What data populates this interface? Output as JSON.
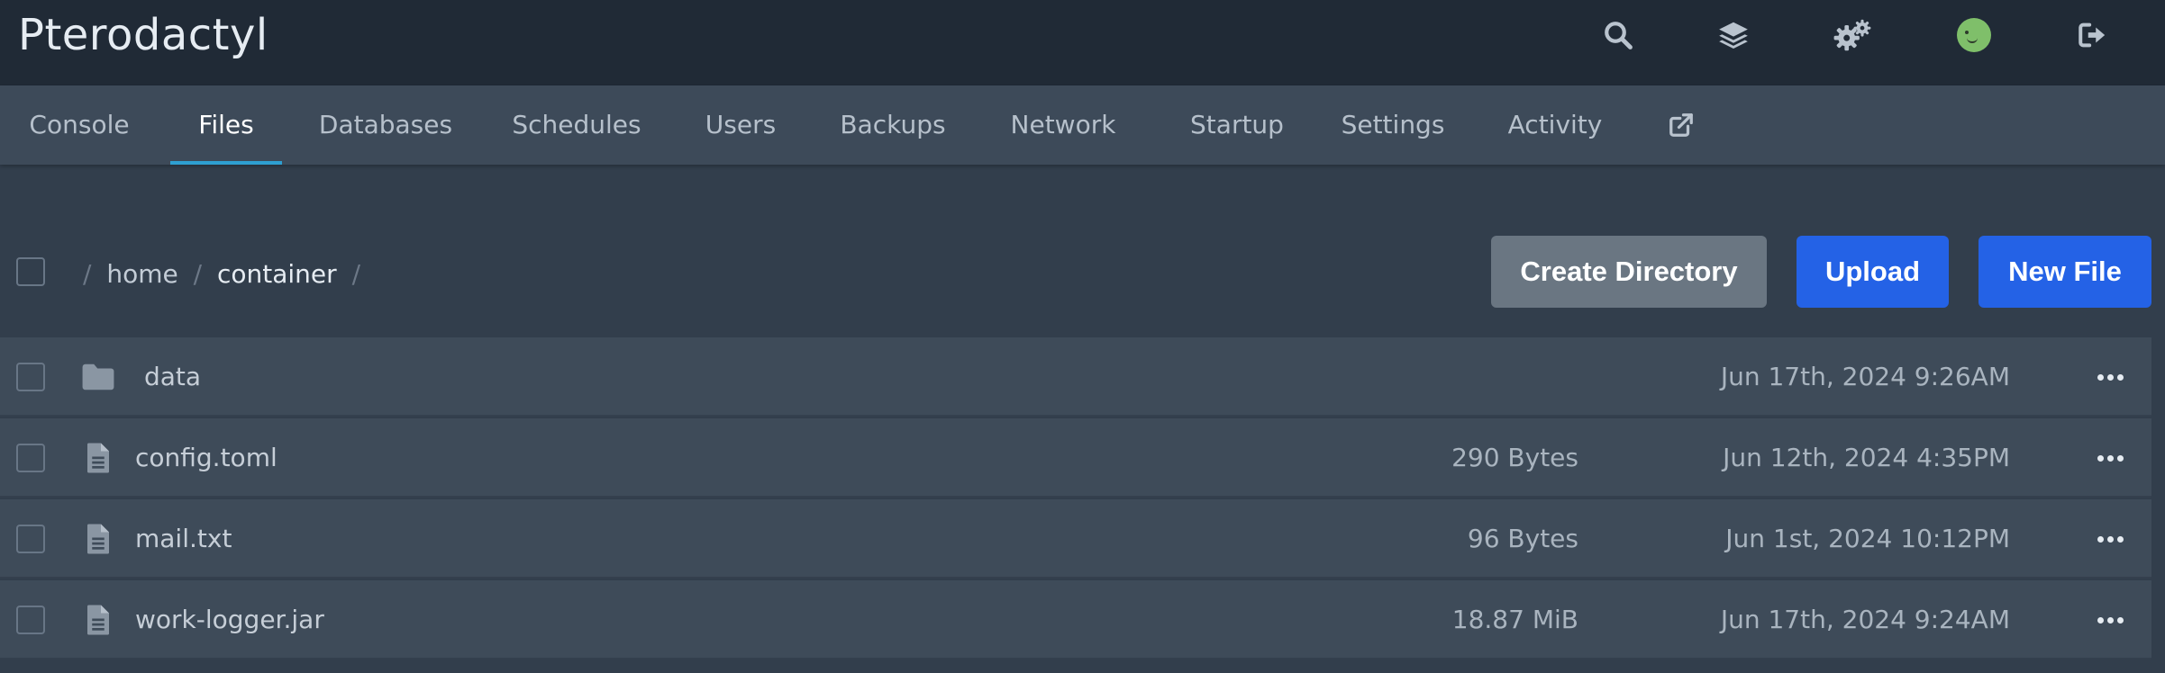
{
  "app": {
    "title": "Pterodactyl"
  },
  "topbar": {
    "icons": [
      "search-icon",
      "layers-icon",
      "gears-icon",
      "avatar",
      "sign-out-icon"
    ]
  },
  "tabs": [
    {
      "label": "Console",
      "active": false
    },
    {
      "label": "Files",
      "active": true
    },
    {
      "label": "Databases",
      "active": false
    },
    {
      "label": "Schedules",
      "active": false
    },
    {
      "label": "Users",
      "active": false
    },
    {
      "label": "Backups",
      "active": false
    },
    {
      "label": "Network",
      "active": false
    },
    {
      "label": "Startup",
      "active": false
    },
    {
      "label": "Settings",
      "active": false
    },
    {
      "label": "Activity",
      "active": false
    }
  ],
  "tab_external_icon": "external-link-icon",
  "breadcrumb": {
    "separator": "/",
    "segments": [
      "home",
      "container"
    ]
  },
  "actions": {
    "create_directory": "Create Directory",
    "upload": "Upload",
    "new_file": "New File"
  },
  "files": [
    {
      "type": "folder",
      "icon": "folder-icon",
      "name": "data",
      "size": "",
      "modified": "Jun 17th, 2024 9:26AM"
    },
    {
      "type": "file",
      "icon": "file-text-icon",
      "name": "config.toml",
      "size": "290 Bytes",
      "modified": "Jun 12th, 2024 4:35PM"
    },
    {
      "type": "file",
      "icon": "file-text-icon",
      "name": "mail.txt",
      "size": "96 Bytes",
      "modified": "Jun 1st, 2024 10:12PM"
    },
    {
      "type": "file",
      "icon": "file-text-icon",
      "name": "work-logger.jar",
      "size": "18.87 MiB",
      "modified": "Jun 17th, 2024 9:24AM"
    }
  ],
  "colors": {
    "topbar": "#202a36",
    "subnav": "#3d4a59",
    "background": "#323e4c",
    "row": "#3e4b59",
    "accent_tab": "#2e9fd1",
    "primary_button": "#2462e6",
    "secondary_button": "#6a7682"
  }
}
